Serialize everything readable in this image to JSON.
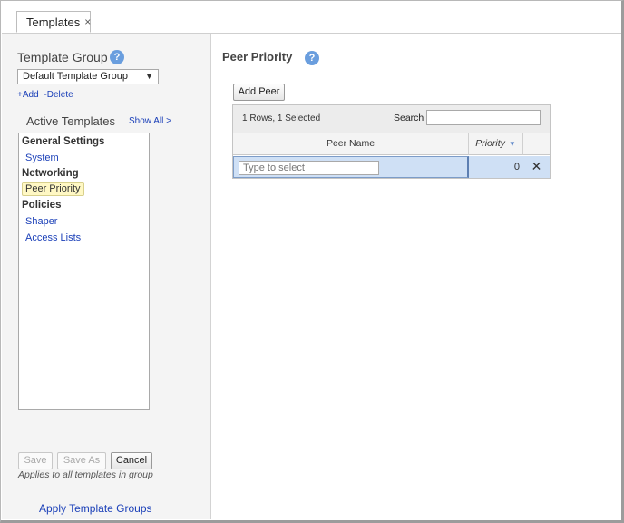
{
  "tabs": [
    {
      "label": "Templates",
      "close": "×"
    }
  ],
  "left_panel": {
    "template_group": {
      "title": "Template Group",
      "help": "?",
      "selected": "Default Template Group",
      "add_label": "+Add",
      "delete_label": "-Delete"
    },
    "active_templates": {
      "title": "Active Templates",
      "show_all": "Show All >",
      "groups": [
        {
          "name": "General Settings",
          "items": [
            {
              "label": "System"
            }
          ]
        },
        {
          "name": "Networking",
          "items": [
            {
              "label": "Peer Priority",
              "selected": true
            }
          ]
        },
        {
          "name": "Policies",
          "items": [
            {
              "label": "Shaper"
            },
            {
              "label": "Access Lists"
            }
          ]
        }
      ]
    },
    "buttons": {
      "save": "Save",
      "save_as": "Save As",
      "cancel": "Cancel"
    },
    "applies_text": "Applies to all templates in group",
    "apply_groups": "Apply Template Groups"
  },
  "main": {
    "title": "Peer Priority",
    "help": "?",
    "add_peer": "Add Peer",
    "rows_info": "1 Rows, 1 Selected",
    "search_label": "Search",
    "search_value": "",
    "columns": {
      "peer_name": "Peer Name",
      "priority": "Priority"
    },
    "rows": [
      {
        "peer_placeholder": "Type to select",
        "priority": "0",
        "delete": "✕"
      }
    ]
  },
  "colors": {
    "accent_blue": "#1a3fb8",
    "help_icon": "#6a9ede",
    "selected_row": "#cfe0f5",
    "selected_item": "#fff8c4"
  }
}
